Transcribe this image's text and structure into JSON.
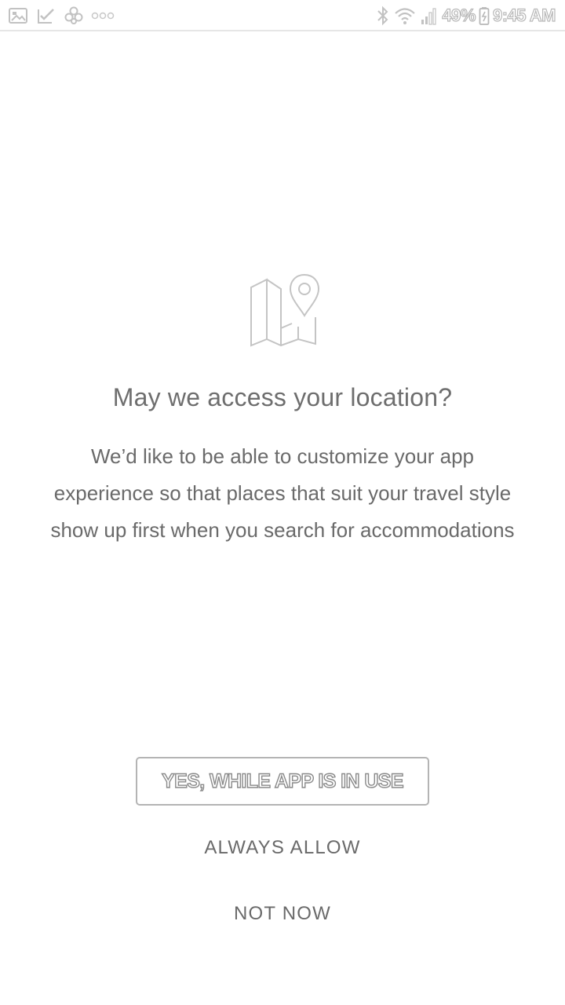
{
  "status_bar": {
    "battery": "49%",
    "time": "9:45 AM",
    "icons": [
      "image-icon",
      "check-icon",
      "pinwheel-icon",
      "more-dots-icon",
      "bluetooth-icon",
      "wifi-icon",
      "signal-icon",
      "battery-icon"
    ]
  },
  "prompt": {
    "icon": "map-location-icon",
    "title": "May we access your location?",
    "description_lines": [
      "We’d like to be able to customize your app",
      "experience so that places that suit your travel style",
      "show up first when you search for accommodations"
    ]
  },
  "actions": {
    "primary_label": "YES, WHILE APP IS IN USE",
    "always_label": "ALWAYS ALLOW",
    "not_now_label": "NOT NOW"
  },
  "colors": {
    "background": "#ffffff",
    "text": "#6a6a6a",
    "border": "#b4b4b4"
  }
}
